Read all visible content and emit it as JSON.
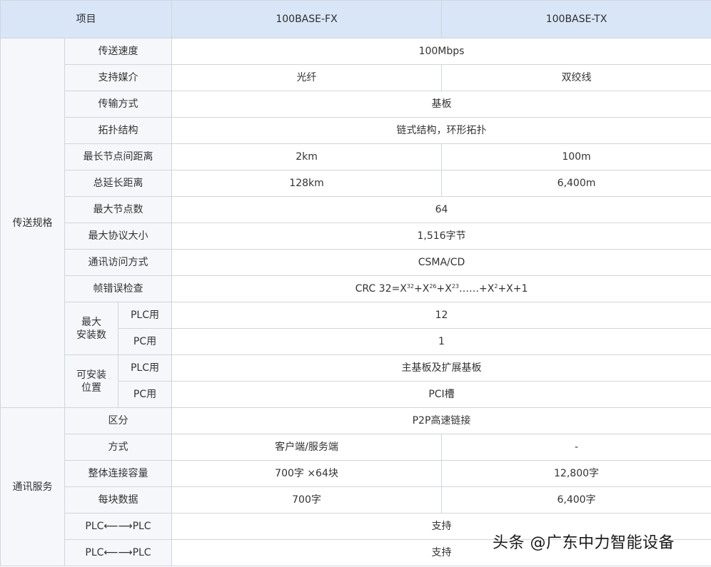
{
  "header": {
    "item": "项目",
    "col_fx": "100BASE-FX",
    "col_tx": "100BASE-TX"
  },
  "groups": {
    "transmission_spec": "传送规格",
    "communication_service": "通讯服务",
    "max_install_count": [
      "最大",
      "安装数"
    ],
    "install_position": [
      "可安装",
      "位置"
    ]
  },
  "rows": {
    "speed": {
      "label": "传送速度",
      "value": "100Mbps"
    },
    "media": {
      "label": "支持媒介",
      "fx": "光纤",
      "tx": "双绞线"
    },
    "method": {
      "label": "传输方式",
      "value": "基板"
    },
    "topology": {
      "label": "拓扑结构",
      "value": "链式结构，环形拓扑"
    },
    "max_node_distance": {
      "label": "最长节点间距离",
      "fx": "2km",
      "tx": "100m"
    },
    "total_extension": {
      "label": "总延长距离",
      "fx": "128km",
      "tx": "6,400m"
    },
    "max_nodes": {
      "label": "最大节点数",
      "value": "64"
    },
    "max_protocol_size": {
      "label": "最大协议大小",
      "value": "1,516字节"
    },
    "access_method": {
      "label": "通讯访问方式",
      "value": "CSMA/CD"
    },
    "frame_check": {
      "label": "帧错误检查",
      "parts": [
        "CRC 32=X",
        "32",
        "+X",
        "26",
        "+X",
        "23",
        "……+X",
        "2",
        "+X+1"
      ]
    },
    "max_plc": {
      "label": "PLC用",
      "value": "12"
    },
    "max_pc": {
      "label": "PC用",
      "value": "1"
    },
    "pos_plc": {
      "label": "PLC用",
      "value": "主基板及扩展基板"
    },
    "pos_pc": {
      "label": "PC用",
      "value": "PCI槽"
    },
    "division": {
      "label": "区分",
      "value": "P2P高速链接"
    },
    "mode": {
      "label": "方式",
      "fx": "客户端/服务端",
      "tx": "-"
    },
    "total_capacity": {
      "label": "整体连接容量",
      "fx": "700字 ×64块",
      "tx": "12,800字"
    },
    "per_block": {
      "label": "每块数据",
      "fx": "700字",
      "tx": "6,400字"
    },
    "plc_plc_1": {
      "label": "PLC⟵⟶PLC",
      "value": "支持"
    },
    "plc_plc_2": {
      "label": "PLC⟵⟶PLC",
      "value": "支持"
    }
  },
  "watermark": "头条 @广东中力智能设备"
}
